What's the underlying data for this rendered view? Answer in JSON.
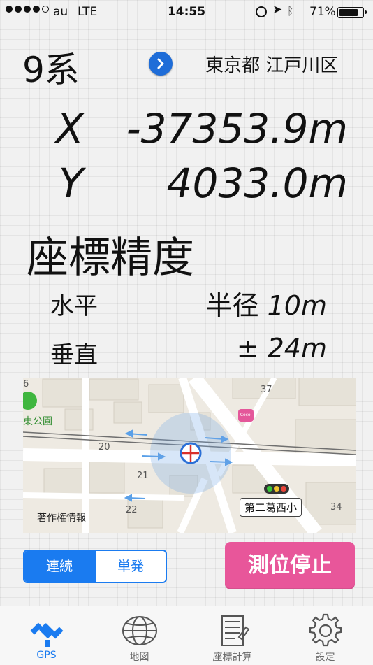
{
  "status_bar": {
    "carrier": "au",
    "network": "LTE",
    "time": "14:55",
    "battery": "71%",
    "battery_level": 0.71
  },
  "header": {
    "coordinate_system": "9系",
    "location": "東京都 江戸川区"
  },
  "coordinates": {
    "x_label": "X",
    "x_value": "-37353.9m",
    "y_label": "Y",
    "y_value": "4033.0m"
  },
  "accuracy": {
    "title": "座標精度",
    "horizontal_label": "水平",
    "horizontal_prefix": "半径",
    "horizontal_value": "10m",
    "vertical_label": "垂直",
    "vertical_prefix": "±",
    "vertical_value": "24m"
  },
  "map": {
    "park_label": "東公園",
    "poi_badge": "Cocol",
    "station_label": "第二葛西小",
    "attribution": "著作権情報",
    "block_numbers": [
      "6",
      "37",
      "20",
      "21",
      "22",
      "34"
    ]
  },
  "controls": {
    "mode_continuous": "連続",
    "mode_single": "単発",
    "stop_button": "測位停止"
  },
  "tabs": [
    {
      "label": "GPS",
      "icon": "satellite-icon",
      "active": true
    },
    {
      "label": "地図",
      "icon": "globe-icon",
      "active": false
    },
    {
      "label": "座標計算",
      "icon": "calculator-memo-icon",
      "active": false
    },
    {
      "label": "設定",
      "icon": "gear-icon",
      "active": false
    }
  ],
  "colors": {
    "accent": "#1a7bf0",
    "stop_button": "#e8569a",
    "chevron_button": "#1f6dd8"
  }
}
